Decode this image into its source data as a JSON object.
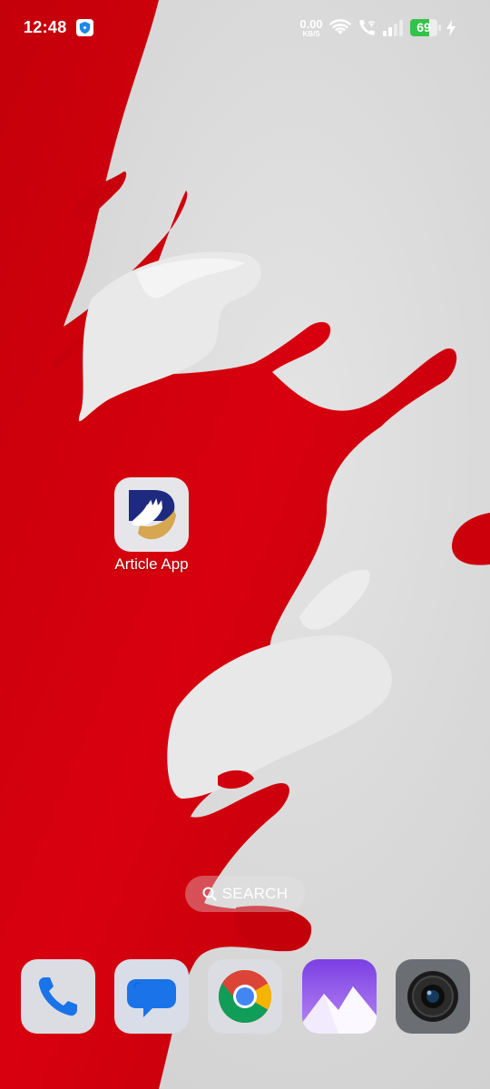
{
  "status_bar": {
    "time": "12:48",
    "net_speed_value": "0.00",
    "net_speed_unit": "KB/S",
    "battery_percent": "69",
    "battery_level": 0.69,
    "icons": [
      "shield-icon",
      "wifi-icon",
      "wifi-call-icon",
      "signal-icon",
      "battery-icon",
      "charging-bolt-icon"
    ]
  },
  "home": {
    "apps": [
      {
        "label": "Article App",
        "icon": "article-app-icon"
      }
    ]
  },
  "search": {
    "label": "SEARCH",
    "icon": "search-icon"
  },
  "dock": {
    "apps": [
      {
        "icon": "phone-icon"
      },
      {
        "icon": "messages-icon"
      },
      {
        "icon": "chrome-icon"
      },
      {
        "icon": "gallery-icon"
      },
      {
        "icon": "camera-icon"
      }
    ]
  },
  "colors": {
    "wallpaper_red": "#d0000d",
    "wallpaper_gray": "#d9d9d9",
    "battery_green": "#34c24a",
    "article_navy": "#1d2a80",
    "article_gold": "#d6a650"
  }
}
